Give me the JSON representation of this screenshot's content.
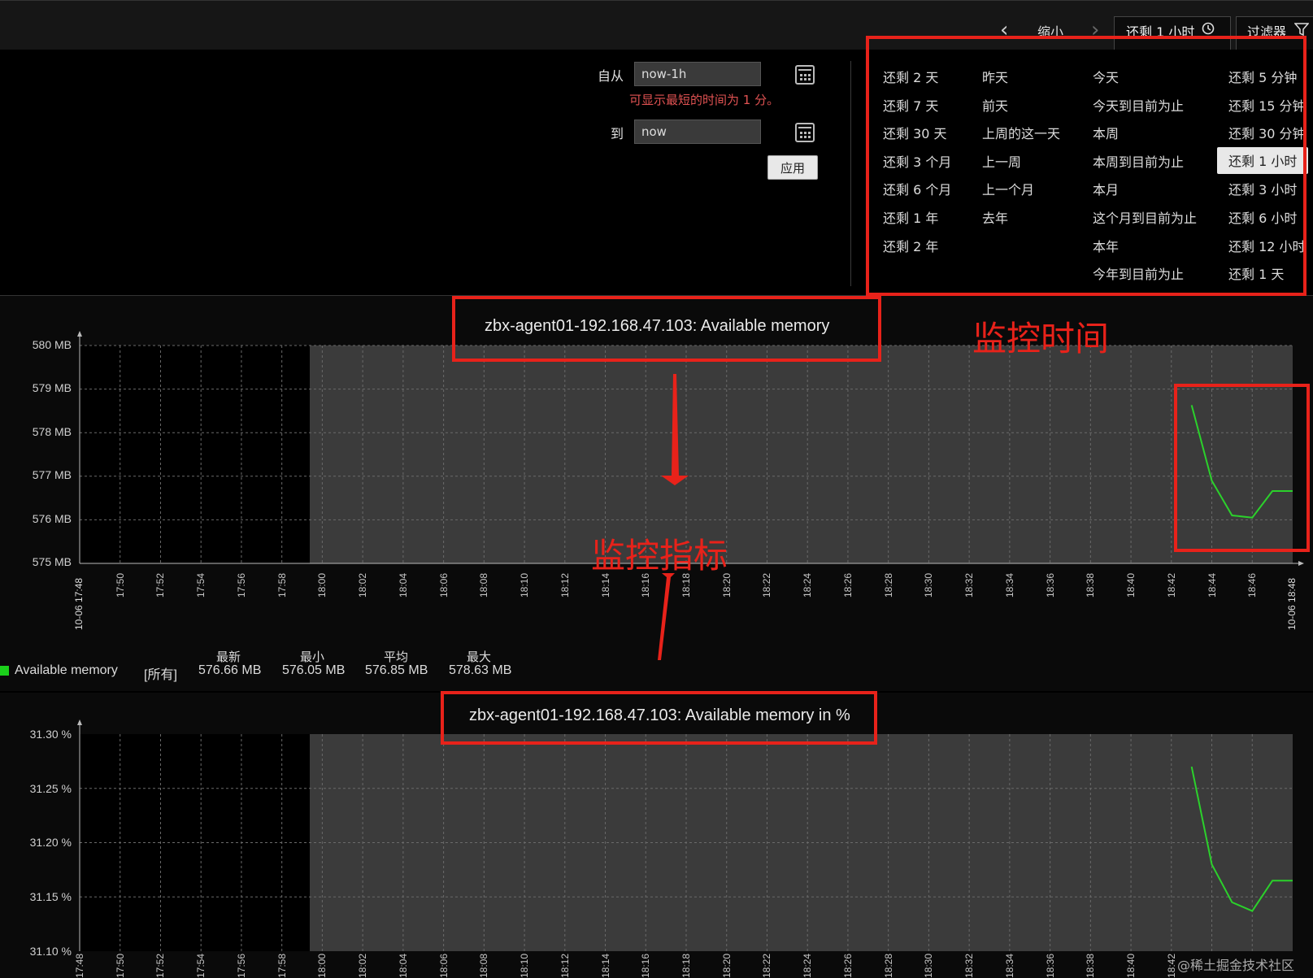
{
  "toolbar": {
    "prev_icon": "chevron-left-icon",
    "next_icon": "chevron-right-icon",
    "zoom_out_label": "缩小",
    "time_tab_label": "还剩 1 小时",
    "clock_icon": "clock-icon",
    "filter_label": "过滤器",
    "filter_icon": "filter-icon"
  },
  "time_form": {
    "from_label": "自从",
    "from_value": "now-1h",
    "hint": "可显示最短的时间为 1 分。",
    "to_label": "到",
    "to_value": "now",
    "apply_label": "应用",
    "calendar_icon": "calendar-icon"
  },
  "quick_ranges": {
    "col1": [
      "还剩 2 天",
      "还剩 7 天",
      "还剩 30 天",
      "还剩 3 个月",
      "还剩 6 个月",
      "还剩 1 年",
      "还剩 2 年"
    ],
    "col2": [
      "昨天",
      "前天",
      "上周的这一天",
      "上一周",
      "上一个月",
      "去年"
    ],
    "col3": [
      "今天",
      "今天到目前为止",
      "本周",
      "本周到目前为止",
      "本月",
      "这个月到目前为止",
      "本年",
      "今年到目前为止"
    ],
    "col4": [
      "还剩 5 分钟",
      "还剩 15 分钟",
      "还剩 30 分钟",
      "还剩 1 小时",
      "还剩 3 小时",
      "还剩 6 小时",
      "还剩 12 小时",
      "还剩 1 天"
    ],
    "selected": "还剩 1 小时"
  },
  "graphs": [
    {
      "title": "zbx-agent01-192.168.47.103: Available memory",
      "y_labels": [
        "580 MB",
        "579 MB",
        "578 MB",
        "577 MB",
        "576 MB",
        "575 MB"
      ],
      "x_start_label": "10-06 17:48",
      "x_end_label": "10-06 18:48",
      "x_labels": [
        "17:50",
        "17:52",
        "17:54",
        "17:56",
        "17:58",
        "18:00",
        "18:02",
        "18:04",
        "18:06",
        "18:08",
        "18:10",
        "18:12",
        "18:14",
        "18:16",
        "18:18",
        "18:20",
        "18:22",
        "18:24",
        "18:26",
        "18:28",
        "18:30",
        "18:32",
        "18:34",
        "18:36",
        "18:38",
        "18:40",
        "18:42",
        "18:44",
        "18:46"
      ],
      "legend": {
        "series_name": "Available memory",
        "scope": "[所有]",
        "headers": [
          "最新",
          "最小",
          "平均",
          "最大"
        ],
        "values": [
          "576.66 MB",
          "576.05 MB",
          "576.85 MB",
          "578.63 MB"
        ],
        "color": "#1bd01b"
      }
    },
    {
      "title": "zbx-agent01-192.168.47.103: Available memory in %",
      "y_labels": [
        "31.30 %",
        "31.25 %",
        "31.20 %",
        "31.15 %",
        "31.10 %"
      ],
      "x_labels": [
        "17:48",
        "17:50",
        "17:52",
        "17:54",
        "17:56",
        "17:58",
        "18:00",
        "18:02",
        "18:04",
        "18:06",
        "18:08",
        "18:10",
        "18:12",
        "18:14",
        "18:16",
        "18:18",
        "18:20",
        "18:22",
        "18:24",
        "18:26",
        "18:28",
        "18:30",
        "18:32",
        "18:34",
        "18:36",
        "18:38",
        "18:40",
        "18:42"
      ]
    }
  ],
  "chart_data": [
    {
      "type": "line",
      "title": "zbx-agent01-192.168.47.103: Available memory",
      "ylim": [
        575,
        580
      ],
      "x": [
        "18:43",
        "18:44",
        "18:45",
        "18:46",
        "18:47",
        "18:48"
      ],
      "series": [
        {
          "name": "Available memory",
          "values": [
            578.63,
            576.9,
            576.1,
            576.05,
            576.66,
            576.66
          ]
        }
      ],
      "xlabel": "",
      "ylabel": "",
      "grid": true
    },
    {
      "type": "line",
      "title": "zbx-agent01-192.168.47.103: Available memory in %",
      "ylim": [
        31.1,
        31.3
      ],
      "x": [
        "18:43",
        "18:44",
        "18:45",
        "18:46",
        "18:47",
        "18:48"
      ],
      "series": [
        {
          "values": [
            31.27,
            31.18,
            31.145,
            31.137,
            31.165,
            31.165
          ]
        }
      ],
      "xlabel": "",
      "ylabel": "",
      "grid": true
    }
  ],
  "annotations": {
    "time_label": "监控时间",
    "metric_label": "监控指标",
    "color": "#e8221a"
  },
  "watermark": "@稀土掘金技术社区"
}
